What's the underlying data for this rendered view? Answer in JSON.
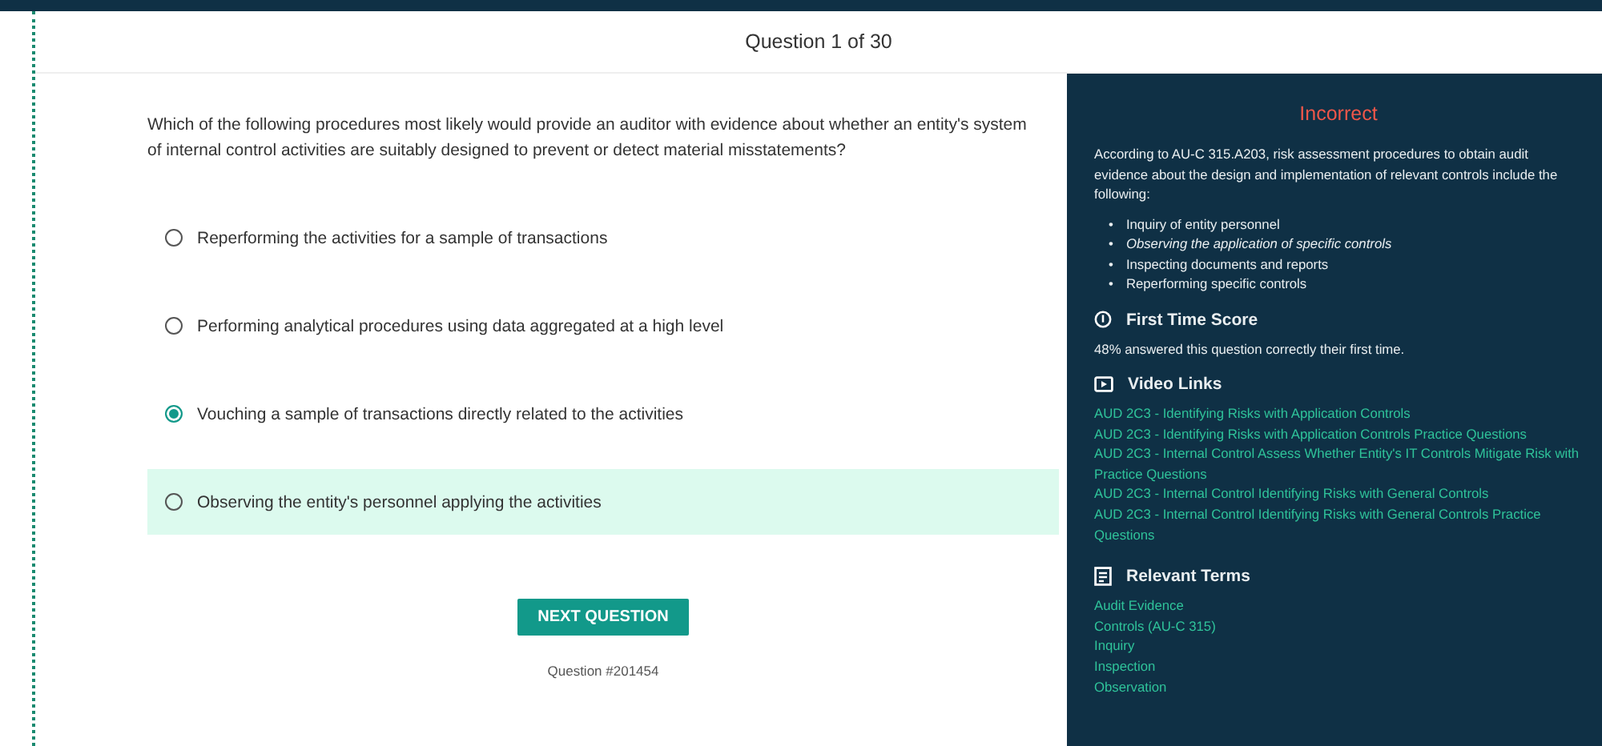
{
  "header": {
    "title": "Question 1 of 30"
  },
  "question": {
    "text": "Which of the following procedures most likely would provide an auditor with evidence about whether an entity's system of internal control activities are suitably designed to prevent or detect material misstatements?",
    "options": [
      {
        "label": "Reperforming the activities for a sample of transactions",
        "selected": false,
        "correct": false
      },
      {
        "label": "Performing analytical procedures using data aggregated at a high level",
        "selected": false,
        "correct": false
      },
      {
        "label": "Vouching a sample of transactions directly related to the activities",
        "selected": true,
        "correct": false
      },
      {
        "label": "Observing the entity's personnel applying the activities",
        "selected": false,
        "correct": true
      }
    ],
    "next_button": "NEXT QUESTION",
    "question_id": "Question #201454"
  },
  "explanation": {
    "verdict": "Incorrect",
    "text": "According to AU-C 315.A203, risk assessment procedures to obtain audit evidence about the design and implementation of relevant controls include the following:",
    "bullets": [
      {
        "marker": "•",
        "text": "Inquiry of entity personnel",
        "italic": false
      },
      {
        "marker": "•",
        "text": "Observing the application of specific controls",
        "italic": true
      },
      {
        "marker": "•",
        "text": "Inspecting documents and reports",
        "italic": false
      },
      {
        "marker": "•",
        "text": "Reperforming specific controls",
        "italic": false
      }
    ],
    "first_time_score": {
      "heading": "First Time Score",
      "text": "48% answered this question correctly their first time."
    },
    "video_links": {
      "heading": "Video Links",
      "links": [
        "AUD 2C3 - Identifying Risks with Application Controls",
        "AUD 2C3 - Identifying Risks with Application Controls Practice Questions",
        "AUD 2C3 - Internal Control Assess Whether Entity's IT Controls Mitigate Risk with Practice Questions",
        "AUD 2C3 - Internal Control Identifying Risks with General Controls",
        "AUD 2C3 - Internal Control Identifying Risks with General Controls Practice Questions"
      ]
    },
    "relevant_terms": {
      "heading": "Relevant Terms",
      "terms": [
        "Audit Evidence",
        "Controls (AU-C 315)",
        "Inquiry",
        "Inspection",
        "Observation"
      ]
    }
  }
}
